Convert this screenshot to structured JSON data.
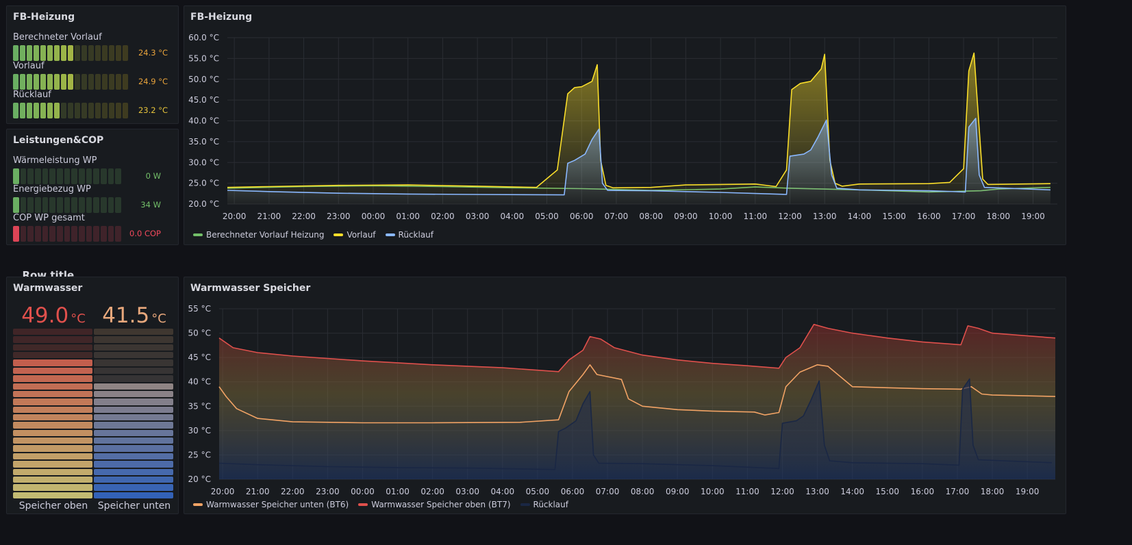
{
  "fb_gauges": {
    "title": "FB-Heizung",
    "items": [
      {
        "label": "Berechneter Vorlauf",
        "value": "24.3 °C",
        "fraction": 0.5,
        "color": "#e8a33b"
      },
      {
        "label": "Vorlauf",
        "value": "24.9 °C",
        "fraction": 0.55,
        "color": "#e8a33b"
      },
      {
        "label": "Rücklauf",
        "value": "23.2 °C",
        "fraction": 0.44,
        "color": "#e8c53b"
      }
    ]
  },
  "cop_gauges": {
    "title": "Leistungen&COP",
    "items": [
      {
        "label": "Wärmeleistung WP",
        "value": "0 W",
        "fraction": 0.04,
        "color": "#73bf69"
      },
      {
        "label": "Energiebezug WP",
        "value": "34 W",
        "fraction": 0.05,
        "color": "#73bf69"
      },
      {
        "label": "COP WP gesamt",
        "value": "0.0 COP",
        "fraction": 0.04,
        "color": "#f2495c"
      }
    ]
  },
  "row": {
    "title": "Row title",
    "chevron_icon": "chevron-down-icon"
  },
  "warmwasser": {
    "title": "Warmwasser",
    "columns": [
      {
        "label": "Speicher oben",
        "value": "49.0",
        "unit": "°C",
        "color": "#e0504c",
        "fraction": 0.82
      },
      {
        "label": "Speicher unten",
        "value": "41.5",
        "unit": "°C",
        "color": "#e8a87c",
        "fraction": 0.66
      }
    ]
  },
  "chart_data": [
    {
      "type": "line",
      "title": "FB-Heizung",
      "x": [
        "20:00",
        "21:00",
        "22:00",
        "23:00",
        "00:00",
        "01:00",
        "02:00",
        "03:00",
        "04:00",
        "05:00",
        "06:00",
        "07:00",
        "08:00",
        "09:00",
        "10:00",
        "11:00",
        "12:00",
        "13:00",
        "14:00",
        "15:00",
        "16:00",
        "17:00",
        "18:00",
        "19:00"
      ],
      "y_ticks": [
        "20.0 °C",
        "25.0 °C",
        "30.0 °C",
        "35.0 °C",
        "40.0 °C",
        "45.0 °C",
        "50.0 °C",
        "55.0 °C",
        "60.0 °C"
      ],
      "ylim": [
        20,
        60
      ],
      "xlim_hours": [
        19.8,
        43.7
      ],
      "series": [
        {
          "name": "Berechneter Vorlauf Heizung",
          "color": "#73bf69",
          "points": [
            [
              19.8,
              23.8
            ],
            [
              22,
              24.2
            ],
            [
              24,
              24.4
            ],
            [
              26,
              24.2
            ],
            [
              28,
              23.9
            ],
            [
              30,
              23.7
            ],
            [
              31,
              23.5
            ],
            [
              32,
              23.3
            ],
            [
              34,
              23.6
            ],
            [
              35,
              24.1
            ],
            [
              36,
              23.8
            ],
            [
              38,
              23.4
            ],
            [
              40,
              22.9
            ],
            [
              41.5,
              23.2
            ],
            [
              42,
              23.6
            ],
            [
              43.5,
              24
            ]
          ]
        },
        {
          "name": "Vorlauf",
          "color": "#fade2a",
          "fill": true,
          "points": [
            [
              19.8,
              24
            ],
            [
              21,
              24.2
            ],
            [
              23,
              24.5
            ],
            [
              25,
              24.6
            ],
            [
              27,
              24.3
            ],
            [
              28.7,
              24
            ],
            [
              29.3,
              28.2
            ],
            [
              29.6,
              46.5
            ],
            [
              29.8,
              48
            ],
            [
              30,
              48.2
            ],
            [
              30.3,
              49.5
            ],
            [
              30.45,
              53.5
            ],
            [
              30.55,
              30.5
            ],
            [
              30.7,
              24.5
            ],
            [
              30.9,
              23.9
            ],
            [
              32,
              24
            ],
            [
              33,
              24.6
            ],
            [
              35,
              24.8
            ],
            [
              35.6,
              24.2
            ],
            [
              35.9,
              28.2
            ],
            [
              36.05,
              47.5
            ],
            [
              36.3,
              49
            ],
            [
              36.6,
              49.5
            ],
            [
              36.9,
              52.5
            ],
            [
              37.0,
              56
            ],
            [
              37.15,
              30.5
            ],
            [
              37.3,
              25
            ],
            [
              37.5,
              24.3
            ],
            [
              38,
              24.8
            ],
            [
              40,
              24.9
            ],
            [
              40.6,
              25.2
            ],
            [
              41.0,
              28.5
            ],
            [
              41.15,
              52
            ],
            [
              41.3,
              56.3
            ],
            [
              41.4,
              44
            ],
            [
              41.55,
              26
            ],
            [
              41.7,
              24.7
            ],
            [
              43.5,
              24.9
            ]
          ]
        },
        {
          "name": "Rücklauf",
          "color": "#8ab8ff",
          "fill": true,
          "points": [
            [
              19.8,
              23.3
            ],
            [
              21,
              23
            ],
            [
              23,
              22.6
            ],
            [
              25,
              22.4
            ],
            [
              27,
              22.3
            ],
            [
              29.5,
              22.2
            ],
            [
              29.6,
              29.8
            ],
            [
              29.8,
              30.5
            ],
            [
              30.1,
              32
            ],
            [
              30.3,
              35.5
            ],
            [
              30.5,
              38
            ],
            [
              30.6,
              25
            ],
            [
              30.75,
              23.3
            ],
            [
              32,
              23.2
            ],
            [
              34,
              22.8
            ],
            [
              35.9,
              22.3
            ],
            [
              36.0,
              31.5
            ],
            [
              36.4,
              32
            ],
            [
              36.6,
              33
            ],
            [
              36.8,
              36
            ],
            [
              37.05,
              40.2
            ],
            [
              37.2,
              27
            ],
            [
              37.35,
              23.8
            ],
            [
              38,
              23.4
            ],
            [
              40,
              23.2
            ],
            [
              41.05,
              22.9
            ],
            [
              41.15,
              38.5
            ],
            [
              41.35,
              40.6
            ],
            [
              41.45,
              27
            ],
            [
              41.6,
              24
            ],
            [
              43.5,
              23.4
            ]
          ]
        }
      ],
      "legend_position": "bottom-left"
    },
    {
      "type": "area",
      "title": "Warmwasser Speicher",
      "x": [
        "20:00",
        "21:00",
        "22:00",
        "23:00",
        "00:00",
        "01:00",
        "02:00",
        "03:00",
        "04:00",
        "05:00",
        "06:00",
        "07:00",
        "08:00",
        "09:00",
        "10:00",
        "11:00",
        "12:00",
        "13:00",
        "14:00",
        "15:00",
        "16:00",
        "17:00",
        "18:00",
        "19:00"
      ],
      "y_ticks": [
        "20 °C",
        "25 °C",
        "30 °C",
        "35 °C",
        "40 °C",
        "45 °C",
        "50 °C",
        "55 °C"
      ],
      "ylim": [
        20,
        55
      ],
      "xlim_hours": [
        19.9,
        43.8
      ],
      "series": [
        {
          "name": "Warmwasser Speicher unten (BT6)",
          "color": "#f2a365",
          "points": [
            [
              19.9,
              39
            ],
            [
              20.1,
              37
            ],
            [
              20.4,
              34.5
            ],
            [
              21,
              32.5
            ],
            [
              22,
              31.8
            ],
            [
              24,
              31.6
            ],
            [
              26,
              31.6
            ],
            [
              28.5,
              31.7
            ],
            [
              29.6,
              32.2
            ],
            [
              29.9,
              38
            ],
            [
              30.3,
              41.5
            ],
            [
              30.5,
              43.5
            ],
            [
              30.7,
              41.5
            ],
            [
              31.4,
              40.5
            ],
            [
              31.6,
              36.5
            ],
            [
              32,
              35
            ],
            [
              33,
              34.3
            ],
            [
              34,
              34
            ],
            [
              35.2,
              33.8
            ],
            [
              35.5,
              33.2
            ],
            [
              35.9,
              33.7
            ],
            [
              36.1,
              39
            ],
            [
              36.5,
              42
            ],
            [
              37,
              43.5
            ],
            [
              37.3,
              43.2
            ],
            [
              38,
              39
            ],
            [
              39,
              38.8
            ],
            [
              40,
              38.6
            ],
            [
              41.1,
              38.5
            ],
            [
              41.4,
              39
            ],
            [
              41.7,
              37.5
            ],
            [
              42,
              37.3
            ],
            [
              43.8,
              37
            ]
          ]
        },
        {
          "name": "Warmwasser Speicher oben (BT7)",
          "color": "#e0504c",
          "points": [
            [
              19.9,
              49
            ],
            [
              20.3,
              47
            ],
            [
              21,
              46
            ],
            [
              22,
              45.3
            ],
            [
              24,
              44.3
            ],
            [
              26,
              43.5
            ],
            [
              28,
              42.9
            ],
            [
              29.6,
              42.1
            ],
            [
              29.9,
              44.5
            ],
            [
              30.3,
              46.5
            ],
            [
              30.5,
              49.3
            ],
            [
              30.8,
              48.8
            ],
            [
              31.2,
              47
            ],
            [
              32,
              45.5
            ],
            [
              33,
              44.5
            ],
            [
              34,
              43.8
            ],
            [
              35,
              43.3
            ],
            [
              35.9,
              42.8
            ],
            [
              36.1,
              45
            ],
            [
              36.5,
              47
            ],
            [
              36.9,
              51.8
            ],
            [
              37.3,
              51
            ],
            [
              38,
              50
            ],
            [
              39,
              49
            ],
            [
              40,
              48.2
            ],
            [
              41.1,
              47.6
            ],
            [
              41.3,
              51.5
            ],
            [
              41.6,
              51
            ],
            [
              42,
              50
            ],
            [
              43.8,
              49
            ]
          ]
        },
        {
          "name": "Rücklauf",
          "color": "#1e2c4f",
          "fill": true,
          "points": [
            [
              19.9,
              23.3
            ],
            [
              21,
              23
            ],
            [
              23,
              22.6
            ],
            [
              25,
              22.4
            ],
            [
              27,
              22.3
            ],
            [
              29.5,
              22
            ],
            [
              29.6,
              29.8
            ],
            [
              29.8,
              30.5
            ],
            [
              30.1,
              32
            ],
            [
              30.3,
              35.5
            ],
            [
              30.5,
              38
            ],
            [
              30.6,
              25
            ],
            [
              30.75,
              23.3
            ],
            [
              32,
              23.2
            ],
            [
              34,
              22.8
            ],
            [
              35.9,
              22.2
            ],
            [
              36.0,
              31.5
            ],
            [
              36.4,
              32
            ],
            [
              36.6,
              33
            ],
            [
              36.8,
              36
            ],
            [
              37.05,
              40.2
            ],
            [
              37.2,
              27
            ],
            [
              37.35,
              23.8
            ],
            [
              38,
              23.4
            ],
            [
              40,
              23.2
            ],
            [
              41.05,
              22.9
            ],
            [
              41.15,
              38.5
            ],
            [
              41.35,
              40.6
            ],
            [
              41.45,
              27
            ],
            [
              41.6,
              24
            ],
            [
              43.7,
              23.4
            ]
          ]
        }
      ],
      "legend_position": "bottom-left"
    }
  ]
}
